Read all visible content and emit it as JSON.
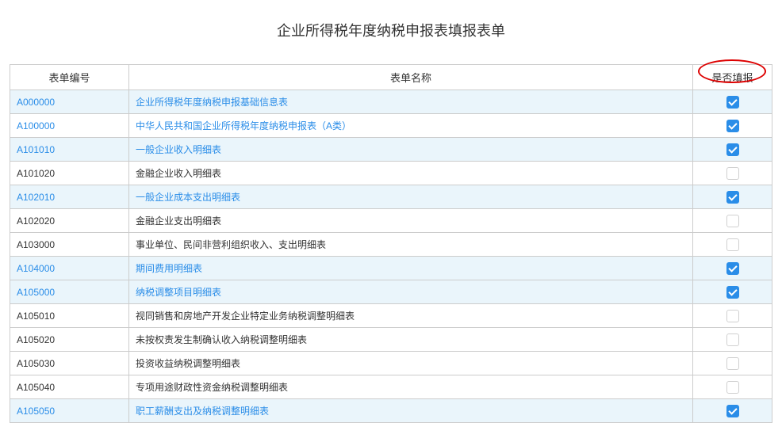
{
  "title": "企业所得税年度纳税申报表填报表单",
  "headers": {
    "code": "表单编号",
    "name": "表单名称",
    "fill": "是否填报"
  },
  "rows": [
    {
      "code": "A000000",
      "name": "企业所得税年度纳税申报基础信息表",
      "checked": true,
      "link": true,
      "hl": true
    },
    {
      "code": "A100000",
      "name": "中华人民共和国企业所得税年度纳税申报表（A类）",
      "checked": true,
      "link": true,
      "hl": false
    },
    {
      "code": "A101010",
      "name": "一般企业收入明细表",
      "checked": true,
      "link": true,
      "hl": true
    },
    {
      "code": "A101020",
      "name": "金融企业收入明细表",
      "checked": false,
      "link": false,
      "hl": false
    },
    {
      "code": "A102010",
      "name": "一般企业成本支出明细表",
      "checked": true,
      "link": true,
      "hl": true
    },
    {
      "code": "A102020",
      "name": "金融企业支出明细表",
      "checked": false,
      "link": false,
      "hl": false
    },
    {
      "code": "A103000",
      "name": "事业单位、民间非营利组织收入、支出明细表",
      "checked": false,
      "link": false,
      "hl": false
    },
    {
      "code": "A104000",
      "name": "期间费用明细表",
      "checked": true,
      "link": true,
      "hl": true
    },
    {
      "code": "A105000",
      "name": "纳税调整项目明细表",
      "checked": true,
      "link": true,
      "hl": true
    },
    {
      "code": "A105010",
      "name": "视同销售和房地产开发企业特定业务纳税调整明细表",
      "checked": false,
      "link": false,
      "hl": false
    },
    {
      "code": "A105020",
      "name": "未按权责发生制确认收入纳税调整明细表",
      "checked": false,
      "link": false,
      "hl": false
    },
    {
      "code": "A105030",
      "name": "投资收益纳税调整明细表",
      "checked": false,
      "link": false,
      "hl": false
    },
    {
      "code": "A105040",
      "name": "专项用途财政性资金纳税调整明细表",
      "checked": false,
      "link": false,
      "hl": false
    },
    {
      "code": "A105050",
      "name": "职工薪酬支出及纳税调整明细表",
      "checked": true,
      "link": true,
      "hl": true
    }
  ]
}
